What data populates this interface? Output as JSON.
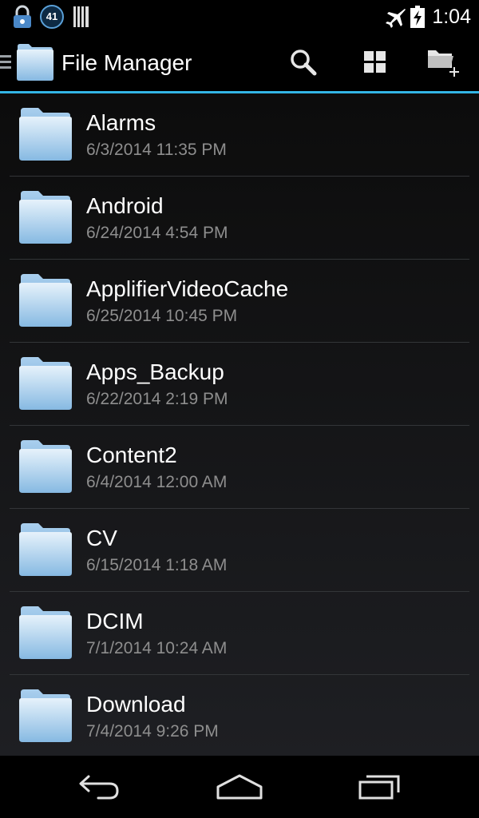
{
  "status_bar": {
    "notification_count": "41",
    "time": "1:04",
    "icons": [
      "lock-icon",
      "barcode-icon",
      "airplane-mode-icon",
      "battery-charging-icon"
    ]
  },
  "action_bar": {
    "title": "File Manager",
    "actions": [
      "search-icon",
      "grid-view-icon",
      "new-folder-icon"
    ],
    "accent_color": "#33b5e5"
  },
  "folders": [
    {
      "name": "Alarms",
      "date": "6/3/2014 11:35 PM"
    },
    {
      "name": "Android",
      "date": "6/24/2014 4:54 PM"
    },
    {
      "name": "ApplifierVideoCache",
      "date": "6/25/2014 10:45 PM"
    },
    {
      "name": "Apps_Backup",
      "date": "6/22/2014 2:19 PM"
    },
    {
      "name": "Content2",
      "date": "6/4/2014 12:00 AM"
    },
    {
      "name": "CV",
      "date": "6/15/2014 1:18 AM"
    },
    {
      "name": "DCIM",
      "date": "7/1/2014 10:24 AM"
    },
    {
      "name": "Download",
      "date": "7/4/2014 9:26 PM"
    }
  ],
  "nav_bar": {
    "buttons": [
      "back-icon",
      "home-icon",
      "recent-apps-icon"
    ]
  }
}
